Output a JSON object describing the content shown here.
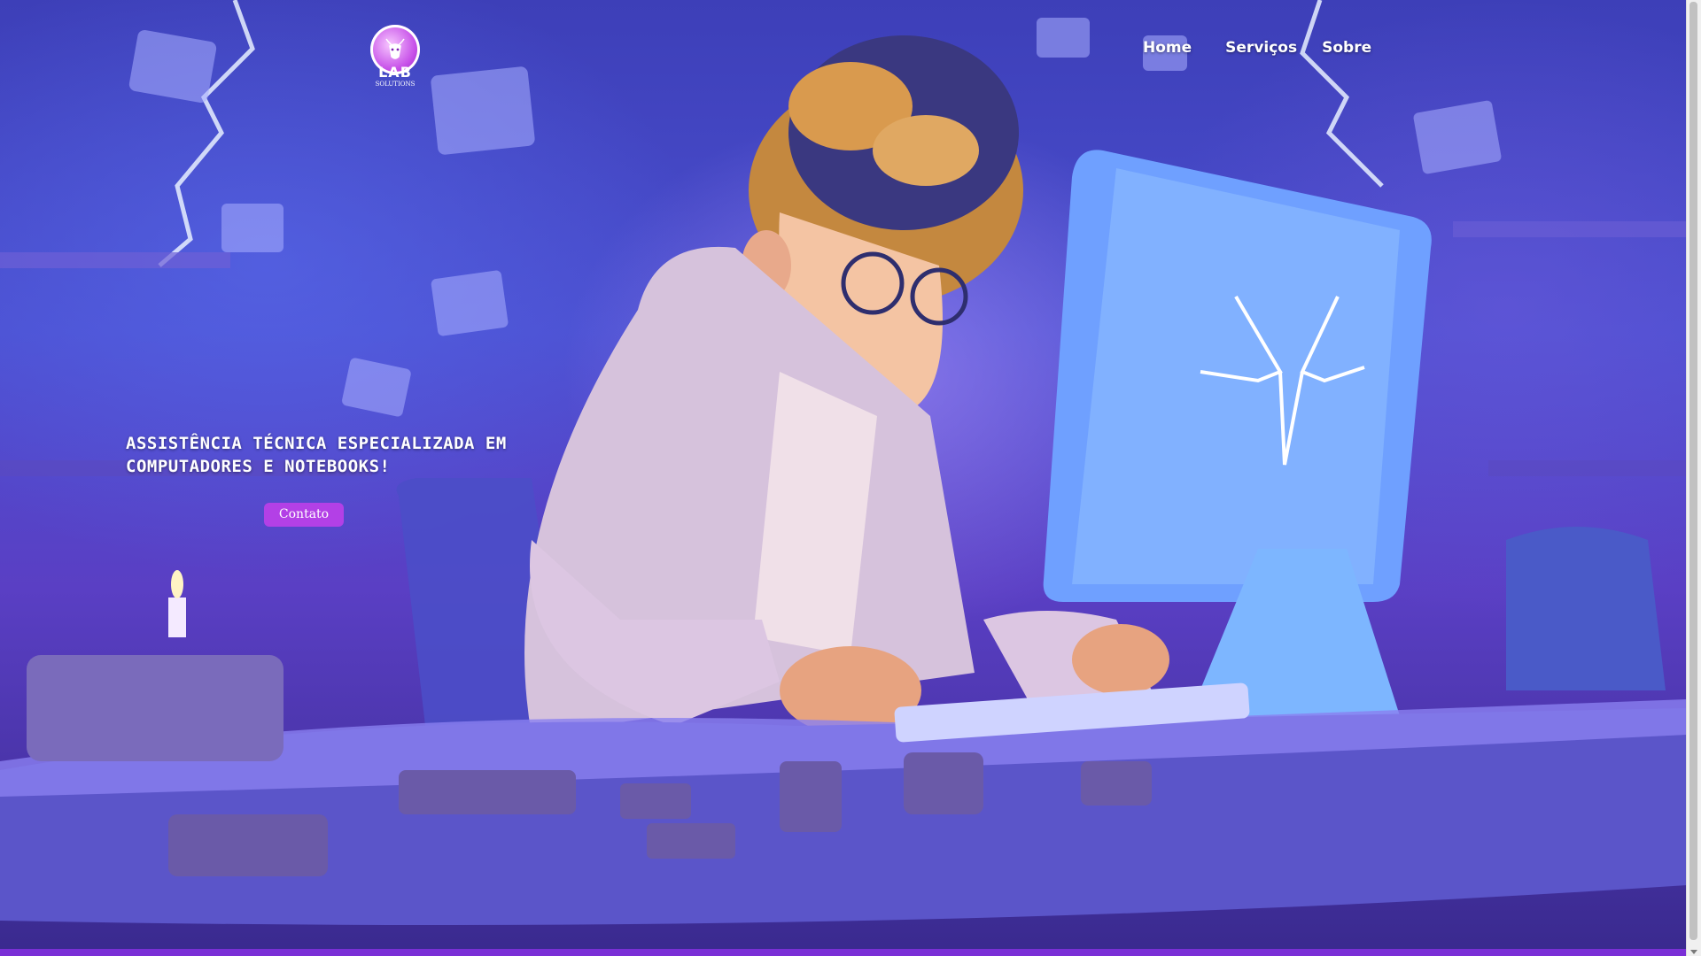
{
  "brand": {
    "logo_text": "LAB",
    "logo_subtext": "SOLUTIONS"
  },
  "nav": {
    "items": [
      {
        "label": "Home"
      },
      {
        "label": "Serviços"
      },
      {
        "label": "Sobre"
      }
    ]
  },
  "hero": {
    "headline_line1": "ASSISTÊNCIA TÉCNICA ESPECIALIZADA EM",
    "headline_line2": "COMPUTADORES E NOTEBOOKS!",
    "cta_label": "Contato",
    "background_illustration": "developer-at-computer-scene"
  },
  "colors": {
    "accent": "#b340e6",
    "bottom_bar": "#7a2fd6",
    "nav_text": "#ffffff"
  }
}
